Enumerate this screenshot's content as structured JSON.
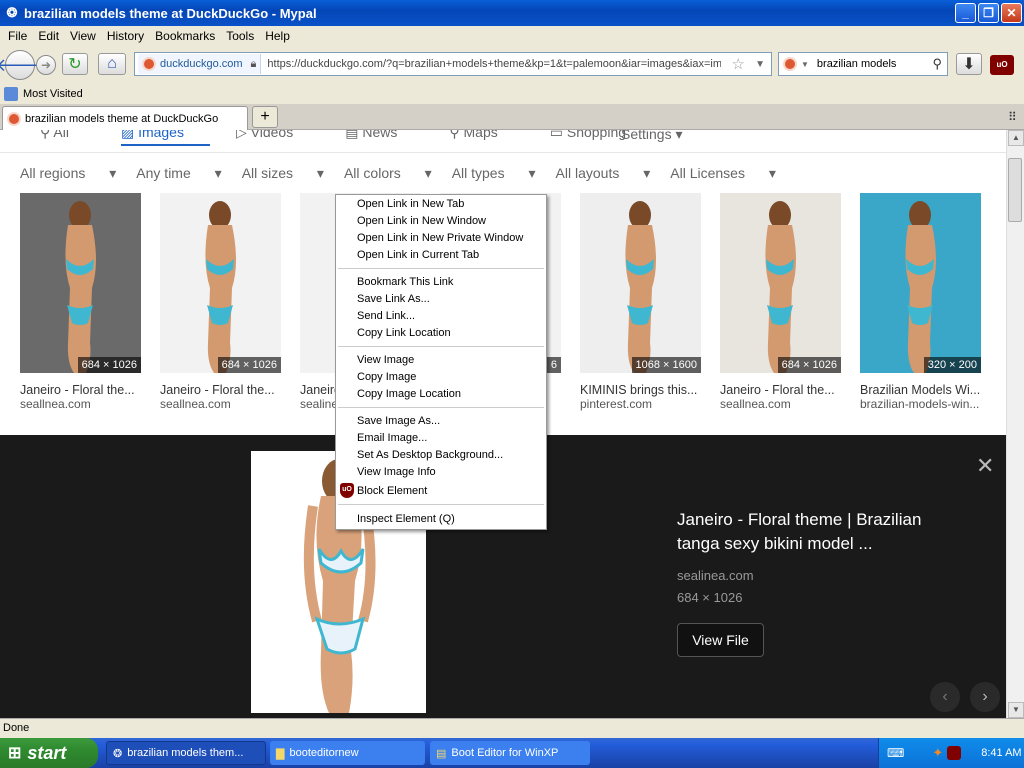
{
  "window": {
    "title": "brazilian models theme at DuckDuckGo - Mypal"
  },
  "menu": [
    "File",
    "Edit",
    "View",
    "History",
    "Bookmarks",
    "Tools",
    "Help"
  ],
  "nav": {
    "site_label": "duckduckgo.com",
    "url": "https://duckduckgo.com/?q=brazilian+models+theme&kp=1&t=palemoon&iar=images&iax=ima",
    "search_value": "brazilian models"
  },
  "bookmarks": {
    "most_visited": "Most Visited"
  },
  "tab": {
    "title": "brazilian models theme at DuckDuckGo",
    "new_tab": "+"
  },
  "ddg": {
    "tabs": [
      "All",
      "Images",
      "Videos",
      "News",
      "Maps",
      "Shopping"
    ],
    "settings": "Settings",
    "filters": [
      "All regions",
      "Any time",
      "All sizes",
      "All colors",
      "All types",
      "All layouts",
      "All Licenses"
    ]
  },
  "results": [
    {
      "title": "Janeiro - Floral the...",
      "source": "seallnea.com",
      "dims": "684 × 1026",
      "bg": "#6a6a6a"
    },
    {
      "title": "Janeiro - Floral the...",
      "source": "seallnea.com",
      "dims": "684 × 1026",
      "bg": "#f2f2f2"
    },
    {
      "title": "Janeiro",
      "source": "sealine",
      "dims": "",
      "bg": "#f2f2f2"
    },
    {
      "title": "",
      "source": "",
      "dims": "6",
      "bg": "#f2f2f2"
    },
    {
      "title": "KIMINIS brings this...",
      "source": "pinterest.com",
      "dims": "1068 × 1600",
      "bg": "#eeeeee"
    },
    {
      "title": "Janeiro - Floral the...",
      "source": "seallnea.com",
      "dims": "684 × 1026",
      "bg": "#e8e4de"
    },
    {
      "title": "Brazilian Models Wi...",
      "source": "brazilian-models-win...",
      "dims": "320 × 200",
      "bg": "#3aa6c8"
    }
  ],
  "detail": {
    "title": "Janeiro - Floral theme | Brazilian tanga sexy bikini model ...",
    "source": "sealinea.com",
    "dims": "684 × 1026",
    "button": "View File",
    "close": "✕",
    "prev": "‹",
    "next": "›"
  },
  "context_menu": {
    "group1": [
      "Open Link in New Tab",
      "Open Link in New Window",
      "Open Link in New Private Window",
      "Open Link in Current Tab"
    ],
    "group2": [
      "Bookmark This Link",
      "Save Link As...",
      "Send Link...",
      "Copy Link Location"
    ],
    "group3": [
      "View Image",
      "Copy Image",
      "Copy Image Location"
    ],
    "group4": [
      "Save Image As...",
      "Email Image...",
      "Set As Desktop Background...",
      "View Image Info",
      "Block Element"
    ],
    "group5": [
      "Inspect Element (Q)"
    ],
    "ublock_badge": "uO"
  },
  "status": "Done",
  "taskbar": {
    "start": "start",
    "tasks": [
      "brazilian models them...",
      "booteditornew",
      "Boot Editor for WinXP"
    ],
    "clock": "8:41 AM"
  }
}
